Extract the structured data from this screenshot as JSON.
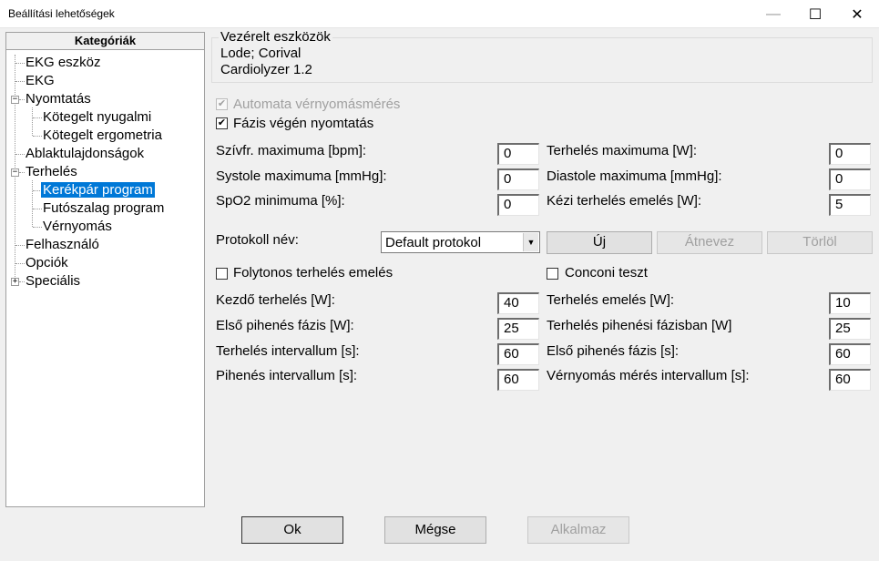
{
  "window": {
    "title": "Beállítási lehetőségek",
    "minimize_icon": "—",
    "maximize_icon": "☐",
    "close_icon": "✕"
  },
  "sidebar": {
    "header": "Kategóriák",
    "items": [
      {
        "label": "EKG eszköz"
      },
      {
        "label": "EKG"
      },
      {
        "label": "Nyomtatás",
        "expander": "−"
      },
      {
        "label": "Kötegelt nyugalmi"
      },
      {
        "label": "Kötegelt ergometria"
      },
      {
        "label": "Ablaktulajdonságok"
      },
      {
        "label": "Terhelés",
        "expander": "−"
      },
      {
        "label": "Kerékpár program",
        "selected": true
      },
      {
        "label": "Futószalag program"
      },
      {
        "label": "Vérnyomás"
      },
      {
        "label": "Felhasználó"
      },
      {
        "label": "Opciók"
      },
      {
        "label": "Speciális",
        "expander": "+"
      }
    ]
  },
  "devices": {
    "group_title": "Vezérelt eszközök",
    "line1": "Lode; Corival",
    "line2": "Cardiolyzer 1.2"
  },
  "options": {
    "auto_bp": {
      "label": "Automata vérnyomásmérés",
      "checked": true,
      "disabled": true,
      "mark": "✔"
    },
    "print_phase_end": {
      "label": "Fázis végén nyomtatás",
      "checked": true,
      "mark": "✔"
    }
  },
  "limits": {
    "hr_max": {
      "label": "Szívfr. maximuma [bpm]:",
      "value": "0"
    },
    "systole_max": {
      "label": "Systole maximuma [mmHg]:",
      "value": "0"
    },
    "spo2_min": {
      "label": "SpO2 minimuma [%]:",
      "value": "0"
    },
    "load_max": {
      "label": "Terhelés maximuma [W]:",
      "value": "0"
    },
    "diastole_max": {
      "label": "Diastole maximuma [mmHg]:",
      "value": "0"
    },
    "manual_load_inc": {
      "label": "Kézi terhelés emelés [W]:",
      "value": "5"
    }
  },
  "protocol": {
    "label": "Protokoll név:",
    "selected": "Default protokol",
    "arrow": "▼",
    "new_label": "Új",
    "rename_label": "Átnevez",
    "delete_label": "Törlöl"
  },
  "continuous": {
    "label": "Folytonos terhelés emelés",
    "checked": false
  },
  "conconi": {
    "label": "Conconi teszt",
    "checked": false
  },
  "params": {
    "start_load": {
      "label": "Kezdő terhelés [W]:",
      "value": "40"
    },
    "first_rest": {
      "label": "Első pihenés fázis   [W]:",
      "value": "25"
    },
    "load_interval": {
      "label": "Terhelés intervallum [s]:",
      "value": "60"
    },
    "rest_interval": {
      "label": "Pihenés intervallum   [s]:",
      "value": "60"
    },
    "load_inc": {
      "label": "Terhelés emelés [W]:",
      "value": "10"
    },
    "load_rest_phase": {
      "label": "Terhelés pihenési fázisban [W]",
      "value": "25"
    },
    "first_rest_s": {
      "label": "Első pihenés fázis    [s]:",
      "value": "60"
    },
    "bp_interval": {
      "label": "Vérnyomás mérés intervallum  [s]:",
      "value": "60"
    }
  },
  "footer": {
    "ok_label": "Ok",
    "cancel_label": "Mégse",
    "apply_label": "Alkalmaz"
  }
}
